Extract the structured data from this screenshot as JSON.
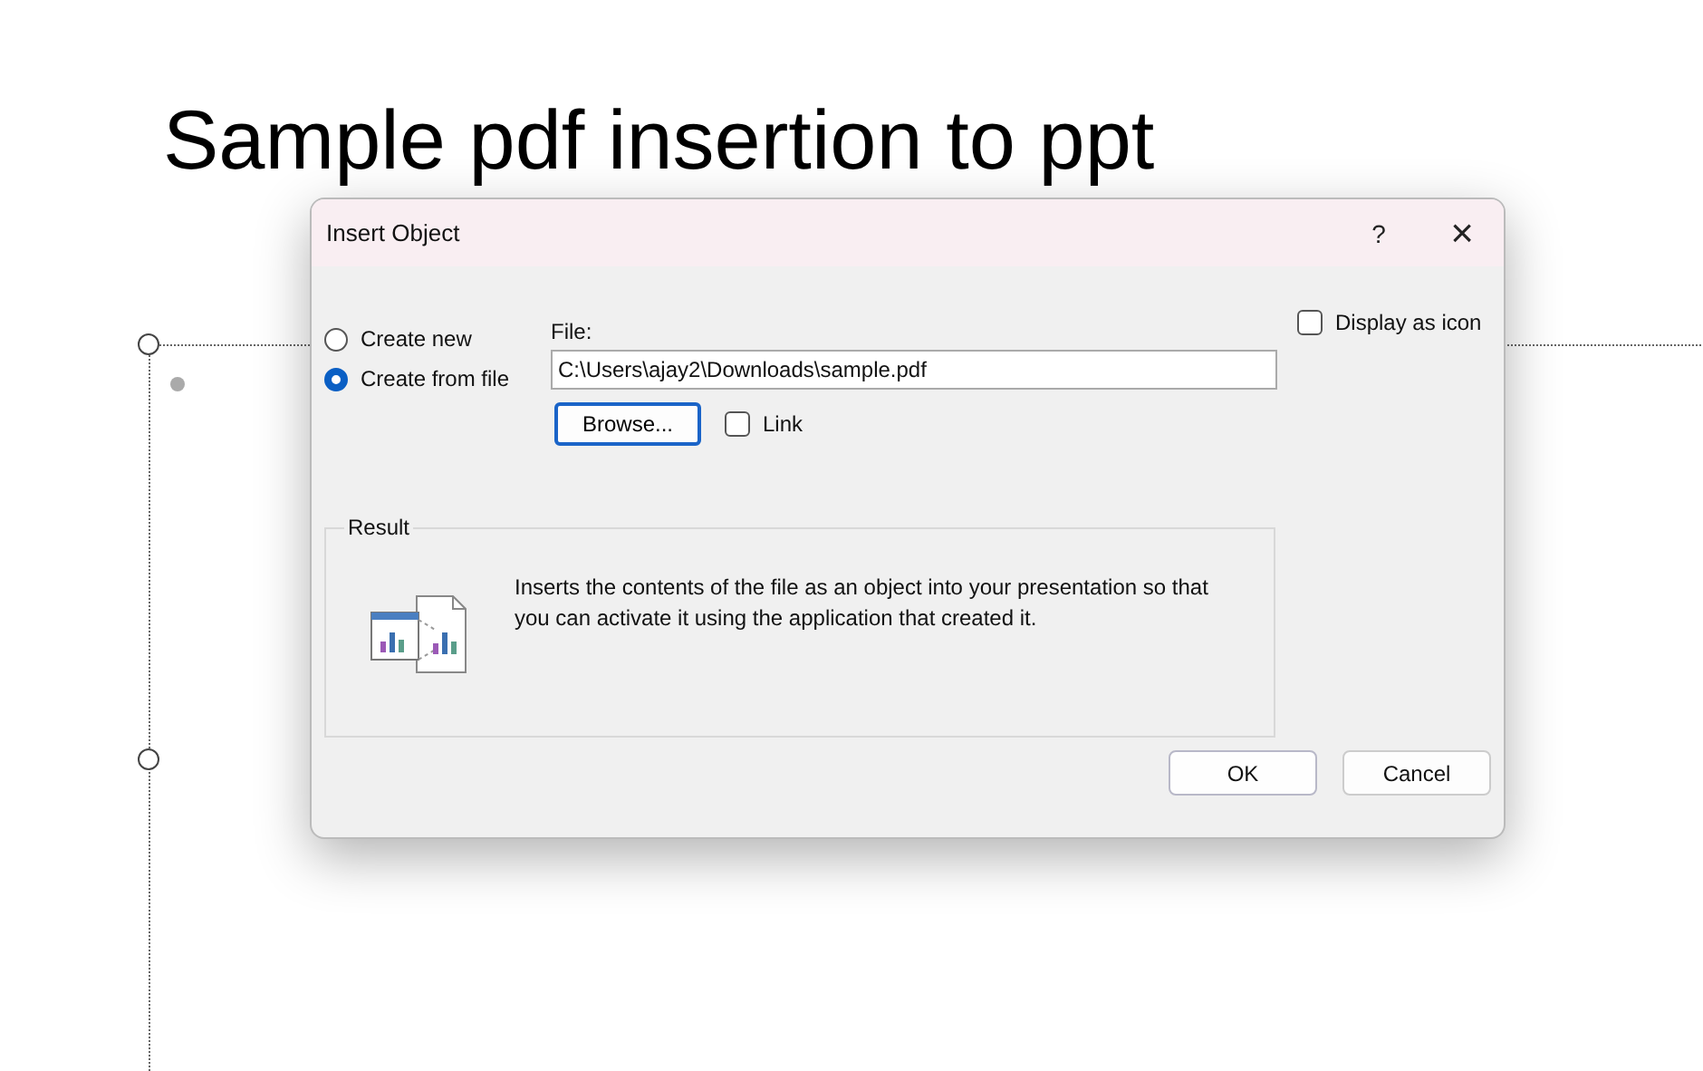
{
  "slide": {
    "title": "Sample pdf insertion to ppt"
  },
  "dialog": {
    "title": "Insert Object",
    "help_button": "?",
    "close_button": "×",
    "options": [
      {
        "label": "Create new",
        "selected": false
      },
      {
        "label": "Create from file",
        "selected": true
      }
    ],
    "file": {
      "label": "File:",
      "value": "C:\\Users\\ajay2\\Downloads\\sample.pdf"
    },
    "browse_button": "Browse...",
    "link": {
      "label": "Link",
      "checked": false
    },
    "display_as_icon": {
      "label": "Display as icon",
      "checked": false
    },
    "result": {
      "heading": "Result",
      "text": "Inserts the contents of the file as an object into your presentation so that you can activate it using the application that created it."
    },
    "buttons": [
      {
        "label": "OK",
        "kind": "default"
      },
      {
        "label": "Cancel",
        "kind": "normal"
      }
    ]
  }
}
